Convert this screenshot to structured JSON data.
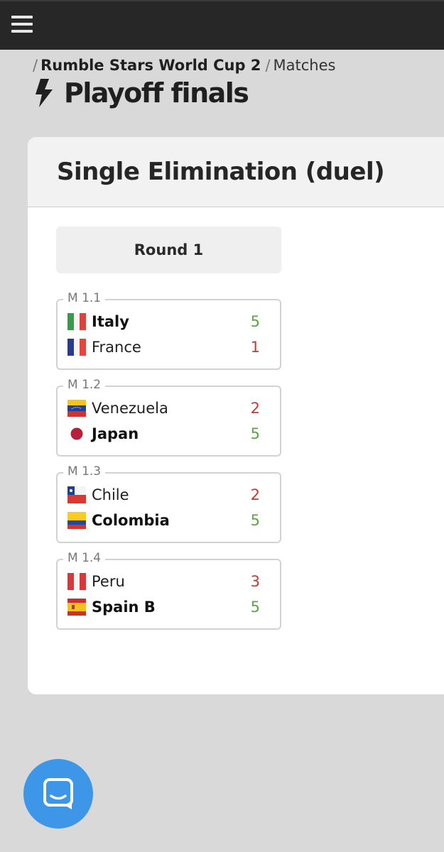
{
  "breadcrumb": {
    "tournament": "Rumble Stars World Cup 2",
    "section": "Matches"
  },
  "page_title": "Playoff finals",
  "bracket": {
    "title": "Single Elimination (duel)",
    "round_label": "Round 1",
    "matches": [
      {
        "id": "M 1.1",
        "team1": {
          "name": "Italy",
          "flag": "italy-flag",
          "score": "5",
          "winner": true
        },
        "team2": {
          "name": "France",
          "flag": "france-flag",
          "score": "1",
          "winner": false
        }
      },
      {
        "id": "M 1.2",
        "team1": {
          "name": "Venezuela",
          "flag": "venezuela-flag",
          "score": "2",
          "winner": false
        },
        "team2": {
          "name": "Japan",
          "flag": "japan-flag",
          "score": "5",
          "winner": true
        }
      },
      {
        "id": "M 1.3",
        "team1": {
          "name": "Chile",
          "flag": "chile-flag",
          "score": "2",
          "winner": false
        },
        "team2": {
          "name": "Colombia",
          "flag": "colombia-flag",
          "score": "5",
          "winner": true
        }
      },
      {
        "id": "M 1.4",
        "team1": {
          "name": "Peru",
          "flag": "peru-flag",
          "score": "3",
          "winner": false
        },
        "team2": {
          "name": "Spain B",
          "flag": "spain-flag",
          "score": "5",
          "winner": true
        }
      }
    ]
  },
  "colors": {
    "topbar": "#272727",
    "page_background": "#d9d9d9",
    "win_score": "#5aa544",
    "lose_score": "#c33a32",
    "chat_button": "#3d96e8"
  },
  "icons": {
    "menu": "hamburger-menu-icon",
    "title": "lightning-bolt-icon",
    "chat": "chat-bubble-icon"
  }
}
